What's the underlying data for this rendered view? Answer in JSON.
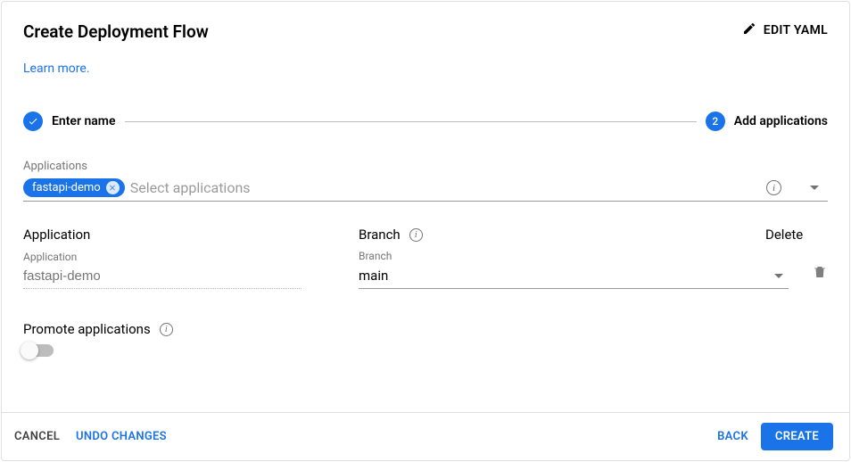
{
  "header": {
    "title": "Create Deployment Flow",
    "edit_yaml": "EDIT YAML",
    "learn_more": "Learn more."
  },
  "stepper": {
    "step1_label": "Enter name",
    "step2_num": "2",
    "step2_label": "Add applications"
  },
  "applications_select": {
    "label": "Applications",
    "chip": "fastapi-demo",
    "placeholder": "Select applications"
  },
  "columns": {
    "application": "Application",
    "branch": "Branch",
    "delete": "Delete"
  },
  "row": {
    "app_label": "Application",
    "app_value": "fastapi-demo",
    "branch_label": "Branch",
    "branch_value": "main"
  },
  "promote": {
    "label": "Promote applications"
  },
  "footer": {
    "cancel": "CANCEL",
    "undo": "UNDO CHANGES",
    "back": "BACK",
    "create": "CREATE"
  }
}
